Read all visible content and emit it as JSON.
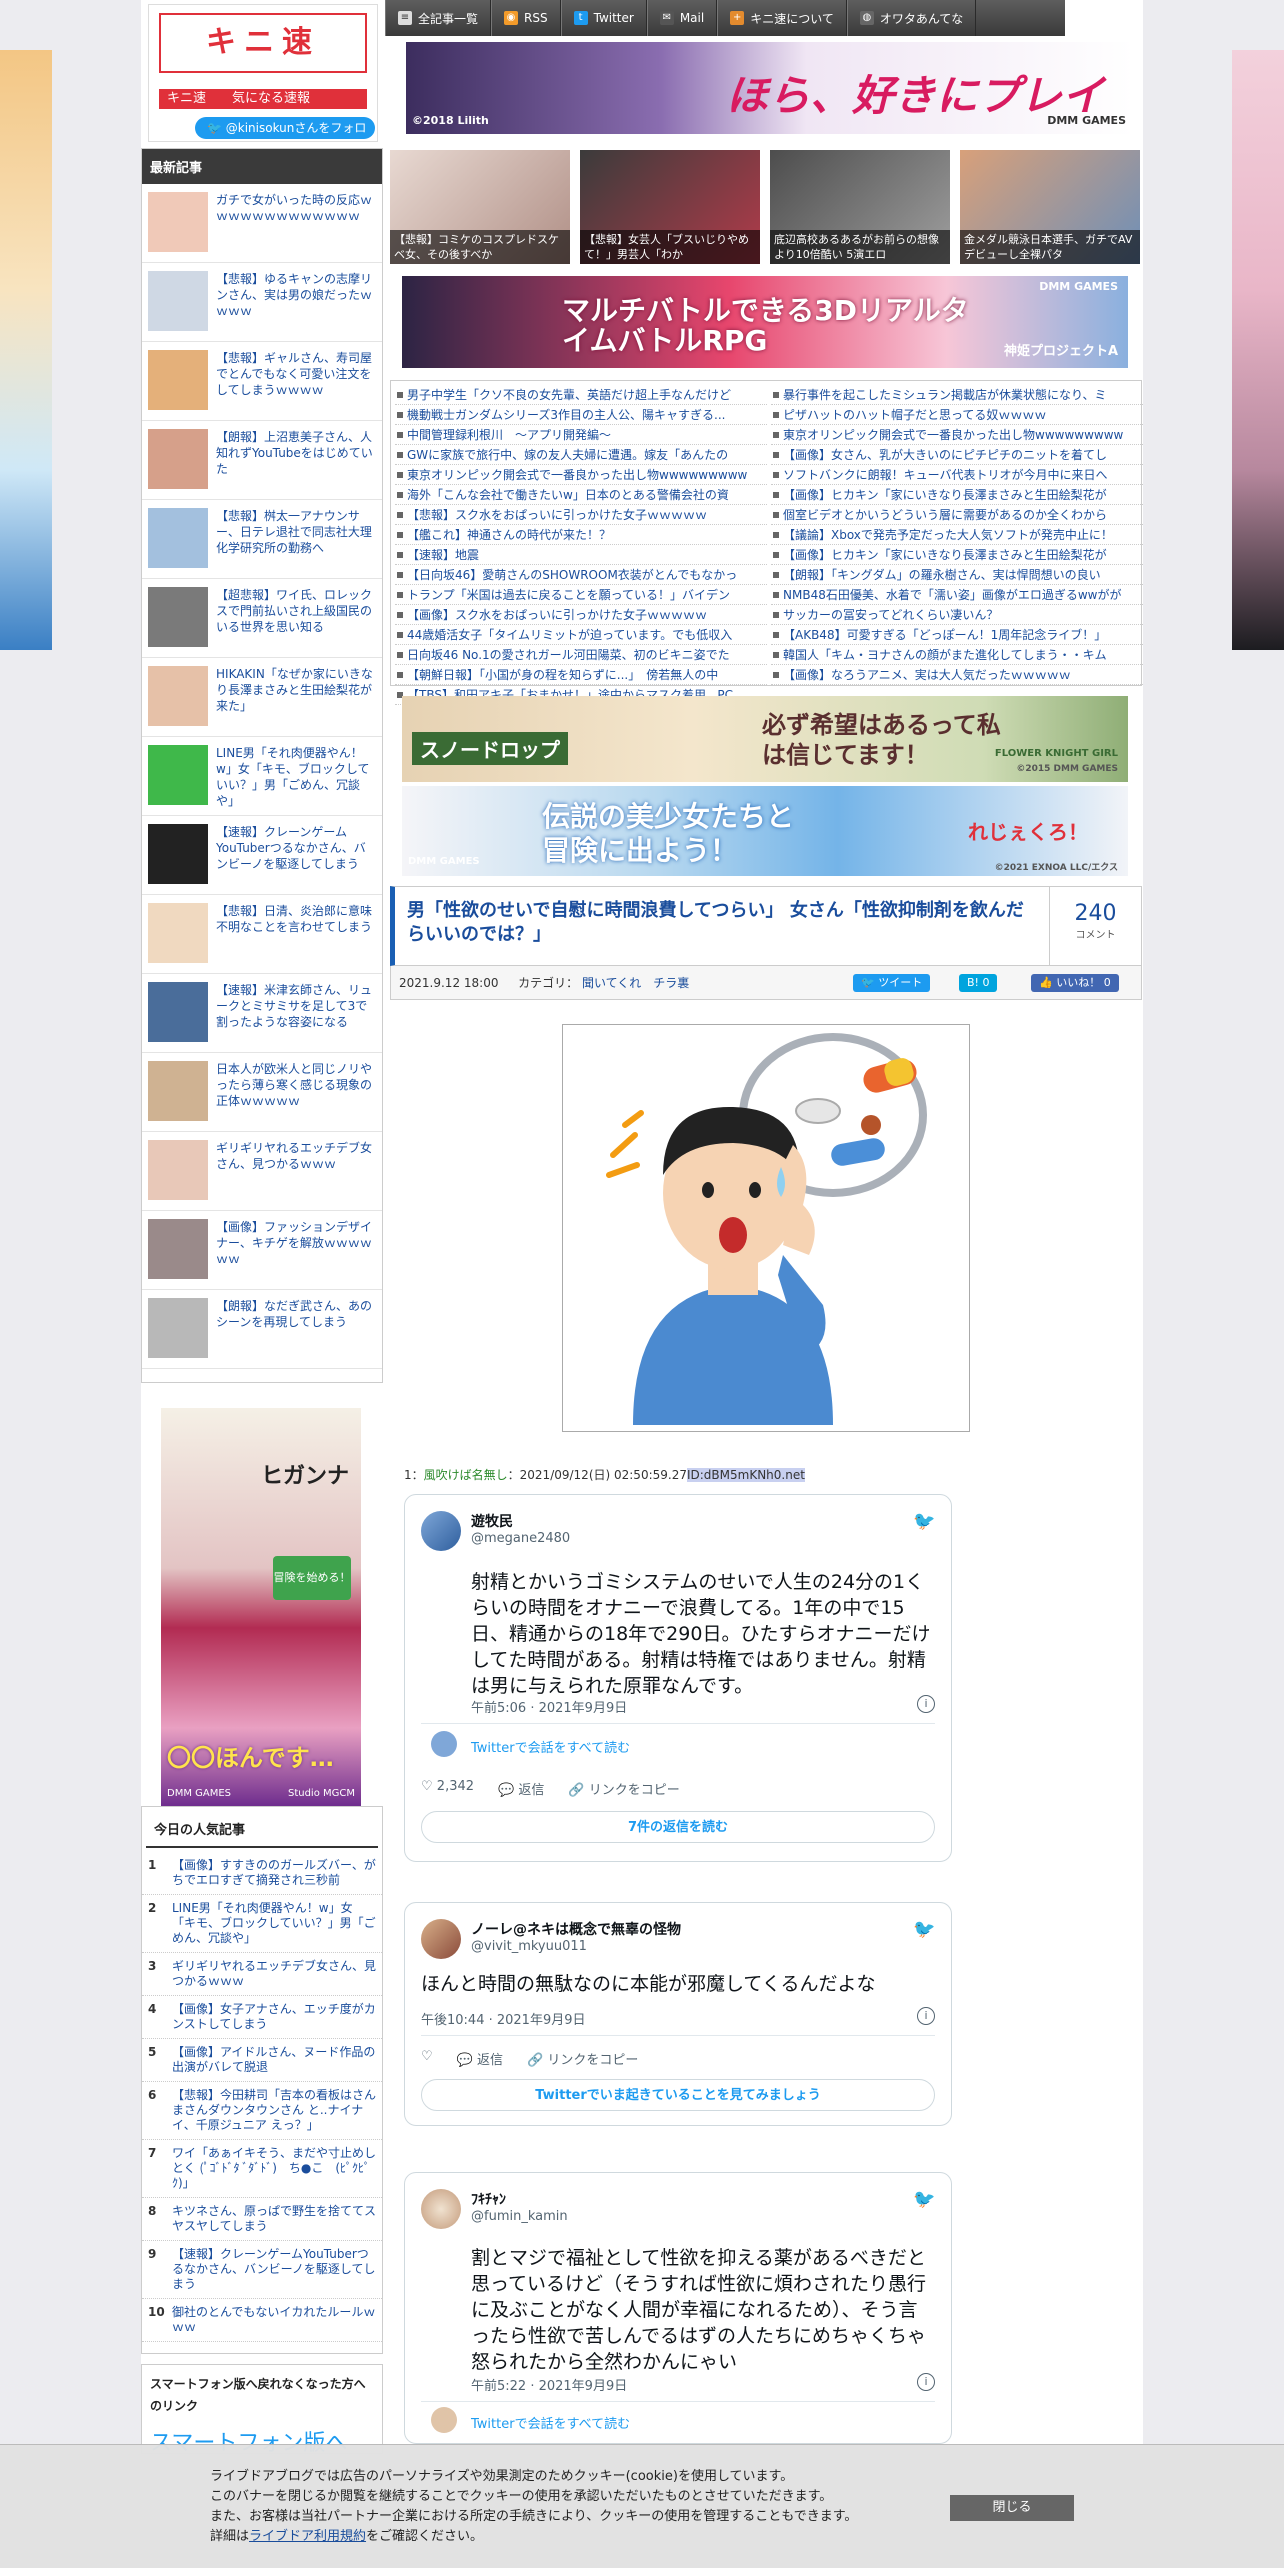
{
  "nav": [
    "全記事一覧",
    "RSS",
    "Twitter",
    "Mail",
    "キニ速について",
    "オワタあんてな"
  ],
  "logo": {
    "mark": "キニ速",
    "tagline": "キニ速　　気になる速報",
    "follow": "@kinisokunさんをフォロー"
  },
  "top_banner": {
    "text": "ほら、好きにプレイして？",
    "copy": "©2018 Lilith",
    "brand": "DMM GAMES"
  },
  "recent": {
    "heading": "最新記事",
    "items": [
      "ガチで女がいった時の反応ｗｗｗｗｗｗｗｗｗｗｗｗｗ",
      "【悲報】ゆるキャンの志摩リンさん、実は男の娘だったｗｗｗｗ",
      "【悲報】ギャルさん、寿司屋でとんでもなく可愛い注文をしてしまうｗｗｗｗ",
      "【朗報】上沼恵美子さん、人知れずYouTubeをはじめていた",
      "【悲報】桝太一アナウンサー、日テレ退社で同志社大理化学研究所の勤務へ",
      "【超悲報】ワイ氏、ロレックスで門前払いされ上級国民のいる世界を思い知る",
      "HIKAKIN「なぜか家にいきなり長澤まさみと生田絵梨花が来た」",
      "LINE男「それ肉便器やん！w」女「キモ、ブロックしていい？」男「ごめん、冗談や」",
      "【速報】クレーンゲームYouTuberつるなかさん、バンビーノを駆逐してしまう",
      "【悲報】日清、炎治郎に意味不明なことを言わせてしまう",
      "【速報】米津玄師さん、リュークとミサミサを足して3で割ったような容姿になる",
      "日本人が欧米人と同じノリやったら薄ら寒く感じる現象の正体ｗｗｗｗｗ",
      "ギリギリヤれるエッチデブ女さん、見つかるｗｗｗ",
      "【画像】ファッションデザイナー、キチゲを解放ｗｗｗｗｗｗ",
      "【朗報】なだぎ武さん、あのシーンを再現してしまう"
    ]
  },
  "side_ad": {
    "title": "ヒガンナ",
    "sub": "〇〇ほんです…",
    "studio": "Studio MGCM",
    "brand": "DMM GAMES",
    "cta": "冒険を始める！"
  },
  "popular": {
    "heading": "今日の人気記事",
    "items": [
      {
        "n": "1",
        "t": "【画像】すすきののガールズバー、がちでエロすぎて摘発され三秒前"
      },
      {
        "n": "2",
        "t": "LINE男「それ肉便器やん！w」女「キモ、ブロックしていい？」男「ごめん、冗談や」"
      },
      {
        "n": "3",
        "t": "ギリギリヤれるエッチデブ女さん、見つかるｗｗｗ"
      },
      {
        "n": "4",
        "t": "【画像】女子アナさん、エッチ度がカンストしてしまう"
      },
      {
        "n": "5",
        "t": "【画像】アイドルさん、ヌード作品の出演がバレて脱退"
      },
      {
        "n": "6",
        "t": "【悲報】今田耕司「吉本の看板はさんまさんダウンタウンさん と..ナイナイ、千原ジュニア えっ？」"
      },
      {
        "n": "7",
        "t": "ワイ「あぁイキそう、まだや寸止めしとく (ﾟｺﾞﾄﾞﾀ ﾞﾀﾞﾄﾞ)　ち●こ　(ﾋﾟｸﾋﾟｸ)」"
      },
      {
        "n": "8",
        "t": "キツネさん、原っぱで野生を捨ててスヤスヤしてしまう"
      },
      {
        "n": "9",
        "t": "【速報】クレーンゲームYouTuberつるなかさん、バンビーノを駆逐してしまう"
      },
      {
        "n": "10",
        "t": "御社のとんでもないイカれたルールｗｗｗ"
      }
    ]
  },
  "smartphone": {
    "heading": "スマートフォン版へ戻れなくなった方へのリンク",
    "link": "スマートフォン版へ"
  },
  "thumbs": [
    "【悲報】コミケのコスプレドスケベ女、その後すべか",
    "【悲報】女芸人「ブスいじりやめて！」男芸人「わか",
    "底辺高校あるあるがお前らの想像より10倍酷い 5演エロ",
    "金メダル競泳日本選手、ガチでAVデビューし全裸パタ"
  ],
  "rpg_banner": {
    "text": "マルチバトルできる3DリアルタイムバトルRPG",
    "title": "神姫プロジェクトA",
    "brand": "DMM GAMES"
  },
  "links_left": [
    "男子中学生「クソ不良の女先輩、英語だけ超上手なんだけど",
    "機動戦士ガンダムシリーズ3作目の主人公、陽キャすぎる...",
    "中間管理録利根川　～アプリ開発編～",
    "GWに家族で旅行中、嫁の友人夫婦に遭遇。嫁友「あんたの",
    "東京オリンピック開会式で一番良かった出し物wwwwwwwww",
    "海外「こんな会社で働きたいw」日本のとある警備会社の資",
    "【悲報】スク水をおぱっいに引っかけた女子ｗｗｗｗｗ",
    "【艦これ】神通さんの時代が来た！？",
    "【速報】地震",
    "【日向坂46】愛萌さんのSHOWROOM衣装がとんでもなかっ",
    "トランプ「米国は過去に戻ることを願っている！」バイデン",
    "【画像】スク水をおぱっいに引っかけた女子ｗｗｗｗｗ",
    "44歳婚活女子「タイムリミットが迫っています。でも低収入",
    "日向坂46 No.1の愛されガール河田陽菜、初のビキニ姿でた",
    "【朝鮮日報】「小国が身の程を知らずに...」　傍若無人の中",
    "【TBS】和田アキ子「おまかせ！」途中からマスク着用...PC"
  ],
  "links_right": [
    "暴行事件を起こしたミシュラン掲載店が休業状態になり、ミ",
    "ピザハットのハット帽子だと思ってる奴ｗｗｗｗ",
    "東京オリンピック開会式で一番良かった出し物wwwwwwwww",
    "【画像】女さん、乳が大きいのにピチピチのニットを着てし",
    "ソフトバンクに朗報！キューバ代表トリオが今月中に来日へ",
    "【画像】ヒカキン「家にいきなり長澤まさみと生田絵梨花が",
    "個室ビデオとかいうどういう層に需要があるのか全くわから",
    "【議論】Xboxで発売予定だった大人気ソフトが発売中止に！",
    "【画像】ヒカキン「家にいきなり長澤まさみと生田絵梨花が",
    "【朗報】「キングダム」の羅永樹さん、実は悍問想いの良い",
    "NMB48石田優美、水着で「濡い姿」画像がエロ過ぎるwwがが",
    "サッカーの冨安ってどれくらい凄いん？",
    "【AKB48】可愛すぎる「どっぽーん！1周年記念ライブ！」",
    "韓国人「キム・ヨナさんの顔がまた進化してしまう・・キム",
    "【画像】なろうアニメ、実は大人気だったｗｗｗｗｗ"
  ],
  "snow_banner": {
    "title": "スノードロップ",
    "text": "必ず希望はあるって私は信じてます！",
    "game": "FLOWER KNIGHT GIRL",
    "copy": "©2015 DMM GAMES"
  },
  "adv_banner": {
    "text": "伝説の美少女たちと冒険に出よう！",
    "game": "れじぇくろ！",
    "copy": "©2021 EXNOA LLC/エクス",
    "brand": "DMM GAMES"
  },
  "article": {
    "title": "男「性欲のせいで自慰に時間浪費してつらい」 女さん「性欲抑制剤を飲んだらいいのでは？」",
    "comment_count": "240",
    "comment_label": "コメント",
    "date": "2021.9.12 18:00",
    "category_label": "カテゴリ：",
    "category": "聞いてくれ　チラ裏",
    "tweet_btn": "ツイート",
    "hatena_btn": "B! 0",
    "like_btn": "いいね！ 0",
    "post_no": "1：",
    "post_name": "風吹けば名無し",
    "post_meta": "：2021/09/12(日) 02:50:59.27",
    "post_id": "ID:dBM5mKNh0.net"
  },
  "tweets": [
    {
      "name": "遊牧民",
      "handle": "@megane2480",
      "text": "射精とかいうゴミシステムのせいで人生の24分の1くらいの時間をオナニーで浪費してる。1年の中で15日、精通からの18年で290日。ひたすらオナニーだけしてた時間がある。射精は特権ではありません。射精は男に与えられた原罪なんです。",
      "time": "午前5:06 · 2021年9月9日",
      "sub": "Twitterで会話をすべて読む",
      "likes": "2,342",
      "reply": "返信",
      "copy": "リンクをコピー",
      "more": "7件の返信を読む"
    },
    {
      "name": "ノーレ@ネキは概念で無辜の怪物",
      "handle": "@vivit_mkyuu011",
      "text": "ほんと時間の無駄なのに本能が邪魔してくるんだよな",
      "time": "午後10:44 · 2021年9月9日",
      "reply": "返信",
      "copy": "リンクをコピー",
      "more": "Twitterでいま起きていることを見てみましょう"
    },
    {
      "name": "ﾌｷﾁｬﾝ",
      "handle": "@fumin_kamin",
      "text": "割とマジで福祉として性欲を抑える薬があるべきだと思っているけど（そうすれば性欲に煩わされたり愚行に及ぶことがなく人間が幸福になれるため）、そう言ったら性欲で苦しんでるはずの人たちにめちゃくちゃ怒られたから全然わかんにゃい",
      "time": "午前5:22 · 2021年9月9日",
      "sub": "Twitterで会話をすべて読む"
    }
  ],
  "cookie": {
    "lines": [
      "ライブドアブログでは広告のパーソナライズや効果測定のためクッキー(cookie)を使用しています。",
      "このバナーを閉じるか閲覧を継続することでクッキーの使用を承認いただいたものとさせていただきます。",
      "また、お客様は当社パートナー企業における所定の手続きにより、クッキーの使用を管理することもできます。"
    ],
    "detail_pre": "詳細は",
    "detail_link": "ライブドア利用規約",
    "detail_post": "をご確認ください。",
    "close": "閉じる"
  },
  "colors": {
    "accent": "#1a4d9c",
    "brand": "#e0303a",
    "twitter": "#1d9bf0"
  }
}
